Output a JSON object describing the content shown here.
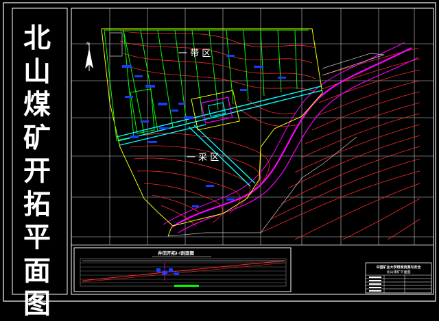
{
  "drawing": {
    "vertical_title_chars": [
      "北",
      "山",
      "煤",
      "矿",
      "开",
      "拓",
      "平",
      "面",
      "图"
    ],
    "zone_label_upper": "一 带 区",
    "zone_label_lower": "一 采 区",
    "section_title": "井田开拓Ⅰ-Ⅰ剖面图",
    "title_block_line1": "中国矿业大学煤炭资源与安全",
    "title_block_line2": "北山煤矿平面图",
    "colors": {
      "frame": "#ffffff",
      "grid": "#ffffff",
      "contour": "#ff2a2a",
      "highway": "#ff00ff",
      "boundary": "#ffff00",
      "workings": "#00ff00",
      "roadway": "#00ffff",
      "labels": "#0000ff"
    },
    "icons": [
      "north-arrow-icon"
    ]
  }
}
